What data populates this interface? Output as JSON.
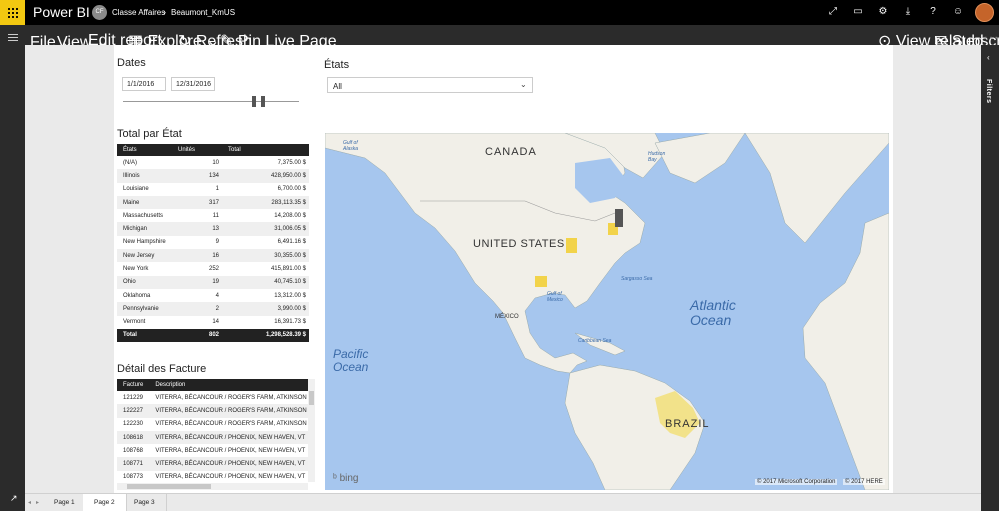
{
  "app": {
    "brand": "Power BI"
  },
  "breadcrumb": {
    "workspace_initials": "CF",
    "workspace": "Classe Affaires",
    "report": "Beaumont_KmUS"
  },
  "topbar_icons": [
    "expand-icon",
    "comment-icon",
    "settings-icon",
    "download-icon",
    "help-icon",
    "smile-icon"
  ],
  "command_bar": {
    "file": "File",
    "view": "View",
    "edit_report": "Edit report",
    "explore": "Explore",
    "refresh": "Refresh",
    "pin_live_page": "Pin Live Page",
    "view_related": "View related",
    "subscribe": "Subscribe"
  },
  "filters_pane": {
    "label": "Filters"
  },
  "dates": {
    "title": "Dates",
    "start": "1/1/2016",
    "end": "12/31/2016"
  },
  "etats_slicer": {
    "title": "États",
    "selected": "All"
  },
  "total_par_etat": {
    "title": "Total par État",
    "columns": [
      "États",
      "Unités",
      "Total"
    ],
    "rows": [
      [
        "(N/A)",
        "10",
        "7,375.00 $"
      ],
      [
        "Illinois",
        "134",
        "428,950.00 $"
      ],
      [
        "Louisiane",
        "1",
        "6,700.00 $"
      ],
      [
        "Maine",
        "317",
        "283,113.35 $"
      ],
      [
        "Massachusetts",
        "11",
        "14,208.00 $"
      ],
      [
        "Michigan",
        "13",
        "31,006.05 $"
      ],
      [
        "New Hampshire",
        "9",
        "6,491.16 $"
      ],
      [
        "New Jersey",
        "16",
        "30,355.00 $"
      ],
      [
        "New York",
        "252",
        "415,891.00 $"
      ],
      [
        "Ohio",
        "19",
        "40,745.10 $"
      ],
      [
        "Oklahoma",
        "4",
        "13,312.00 $"
      ],
      [
        "Pennsylvanie",
        "2",
        "3,990.00 $"
      ],
      [
        "Vermont",
        "14",
        "16,391.73 $"
      ]
    ],
    "total": [
      "Total",
      "802",
      "1,298,528.39 $"
    ]
  },
  "detail_facture": {
    "title": "Détail des Facture",
    "columns": [
      "Facture",
      "Description"
    ],
    "rows": [
      [
        "121229",
        "VITERRA, BÉCANCOUR / ROGER'S FARM, ATKINSON"
      ],
      [
        "122227",
        "VITERRA, BÉCANCOUR / ROGER'S FARM, ATKINSON"
      ],
      [
        "122230",
        "VITERRA, BÉCANCOUR / ROGER'S FARM, ATKINSON"
      ],
      [
        "108618",
        "VITERRA, BÉCANCOUR / PHOENIX, NEW HAVEN, VT"
      ],
      [
        "108768",
        "VITERRA, BÉCANCOUR / PHOENIX, NEW HAVEN, VT"
      ],
      [
        "108771",
        "VITERRA, BÉCANCOUR / PHOENIX, NEW HAVEN, VT"
      ],
      [
        "108773",
        "VITERRA, BÉCANCOUR / PHOENIX, NEW HAVEN, VT"
      ]
    ]
  },
  "map": {
    "labels": {
      "canada": "CANADA",
      "united_states": "UNITED STATES",
      "mexico": "MÉXICO",
      "brazil": "BRAZIL",
      "pacific": "Pacific Ocean",
      "atlantic": "Atlantic Ocean",
      "gulf_alaska": "Gulf of Alaska",
      "hudson": "Hudson Bay",
      "sargasso": "Sargasso Sea",
      "gulf_mexico": "Gulf of Mexico",
      "caribbean": "Caribbean Sea"
    },
    "bing": "bing",
    "copyright_ms": "© 2017 Microsoft Corporation",
    "copyright_here": "© 2017 HERE",
    "highlight_color": "#f2c811",
    "selected_color": "#555555"
  },
  "pages": [
    "Page 1",
    "Page 2",
    "Page 3"
  ],
  "active_page": "Page 2"
}
